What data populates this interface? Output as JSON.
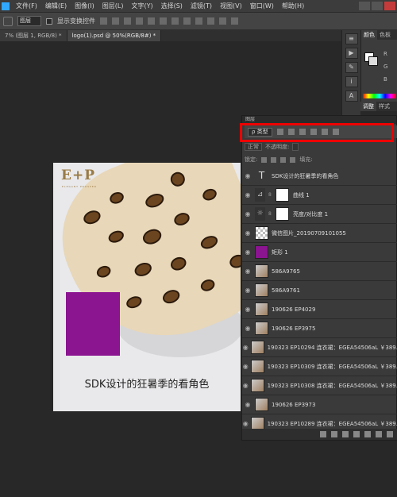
{
  "menubar": {
    "items": [
      "文件(F)",
      "编辑(E)",
      "图像(I)",
      "图层(L)",
      "文字(Y)",
      "选择(S)",
      "滤镜(T)",
      "视图(V)",
      "窗口(W)",
      "帮助(H)"
    ]
  },
  "options": {
    "auto_select": "图层",
    "show_transform": "显示变换控件"
  },
  "tabs": [
    "7% (图层 1, RGB/8) *",
    "logo(1).psd @ 50%(RGB/8#) *"
  ],
  "document": {
    "logo": "E+P",
    "logo_sub": "ELEGANT PROSPER",
    "caption": "SDK设计的狂暑季的看角色"
  },
  "color_panel": {
    "tabs": [
      "颜色",
      "色板"
    ],
    "r": "R",
    "g": "G",
    "b": "B",
    "adjust_tabs": [
      "调整",
      "样式"
    ]
  },
  "layers_panel": {
    "title": "图层",
    "filter_type": "ρ 类型",
    "blend_mode": "正常",
    "opacity_label": "不透明度:",
    "lock_label": "锁定:",
    "fill_label": "填充:",
    "layers": [
      {
        "name": "SDK设计的狂暑季的看角色",
        "thumb": "t-text",
        "thumb_char": "T",
        "mask": false
      },
      {
        "name": "曲线 1",
        "thumb": "t-adj",
        "thumb_char": "⊿",
        "mask": true
      },
      {
        "name": "亮度/对比度 1",
        "thumb": "t-adj",
        "thumb_char": "☼",
        "mask": true
      },
      {
        "name": "微信图片_20190709101055",
        "thumb": "t-check",
        "thumb_char": "",
        "mask": false
      },
      {
        "name": "矩形 1",
        "thumb": "t-purple",
        "thumb_char": "",
        "mask": false
      },
      {
        "name": "586A9765",
        "thumb": "t-photo",
        "thumb_char": "",
        "mask": false
      },
      {
        "name": "586A9761",
        "thumb": "t-photo",
        "thumb_char": "",
        "mask": false
      },
      {
        "name": "190626 EP4029",
        "thumb": "t-photo",
        "thumb_char": "",
        "mask": false
      },
      {
        "name": "190626 EP3975",
        "thumb": "t-photo",
        "thumb_char": "",
        "mask": false
      },
      {
        "name": "190323 EP10294 连衣裙：EGEA54506aL ￥389.",
        "thumb": "t-photo",
        "thumb_char": "",
        "mask": false
      },
      {
        "name": "190323 EP10309 连衣裙：EGEA54506aL ￥389.",
        "thumb": "t-photo",
        "thumb_char": "",
        "mask": false
      },
      {
        "name": "190323 EP10308 连衣裙：EGEA54506aL ￥389.",
        "thumb": "t-photo",
        "thumb_char": "",
        "mask": false
      },
      {
        "name": "190626 EP3973",
        "thumb": "t-photo",
        "thumb_char": "",
        "mask": false
      },
      {
        "name": "190323 EP10289 连衣裙：EGEA54506aL ￥389.",
        "thumb": "t-photo",
        "thumb_char": "",
        "mask": false
      }
    ]
  },
  "colors": {
    "purple": "#8b1490",
    "highlight": "#ee0000",
    "logo_gold": "#9a7b46"
  }
}
